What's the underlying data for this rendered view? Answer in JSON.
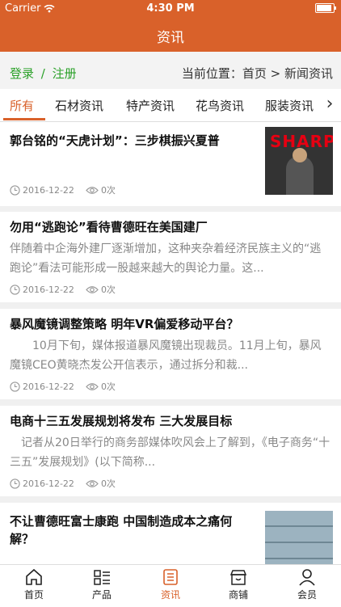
{
  "status_bar": {
    "carrier": "Carrier",
    "time": "4:30 PM"
  },
  "nav": {
    "title": "资讯"
  },
  "location": {
    "login": "登录",
    "separator": "/",
    "register": "注册",
    "breadcrumb": "当前位置：首页 > 新闻资讯"
  },
  "tabs": [
    {
      "label": "所有",
      "active": true
    },
    {
      "label": "石材资讯",
      "active": false
    },
    {
      "label": "特产资讯",
      "active": false
    },
    {
      "label": "花鸟资讯",
      "active": false
    },
    {
      "label": "服装资讯",
      "active": false
    }
  ],
  "news": [
    {
      "title": "郭台铭的“天虎计划”：三步棋振兴夏普",
      "summary": "",
      "date": "2016-12-22",
      "views": "0次",
      "thumb_text": "SHARP"
    },
    {
      "title": "勿用“逃跑论”看待曹德旺在美国建厂",
      "summary": "伴随着中企海外建厂逐渐增加，这种夹杂着经济民族主义的“逃跑论”看法可能形成一股越来越大的舆论力量。这...",
      "date": "2016-12-22",
      "views": "0次"
    },
    {
      "title": "暴风魔镜调整策略 明年VR偏爱移动平台？",
      "summary": "　　10月下旬，媒体报道暴风魔镜出现裁员。11月上旬，暴风魔镜CEO黄晓杰发公开信表示，通过拆分和裁...",
      "date": "2016-12-22",
      "views": "0次"
    },
    {
      "title": "电商十三五发展规划将发布 三大发展目标",
      "summary": "　记者从20日举行的商务部媒体吹风会上了解到，《电子商务“十三五”发展规划》(以下简称...",
      "date": "2016-12-22",
      "views": "0次"
    },
    {
      "title": "不让曹德旺富士康跑 中国制造成本之痛何解？",
      "summary": "",
      "date": "",
      "views": ""
    }
  ],
  "footer": [
    {
      "label": "首页",
      "icon": "home-icon",
      "active": false
    },
    {
      "label": "产品",
      "icon": "list-icon",
      "active": false
    },
    {
      "label": "资讯",
      "icon": "news-icon",
      "active": true
    },
    {
      "label": "商铺",
      "icon": "shop-icon",
      "active": false
    },
    {
      "label": "会员",
      "icon": "user-icon",
      "active": false
    }
  ],
  "colors": {
    "brand": "#d9612a",
    "link_green": "#2aa128"
  }
}
